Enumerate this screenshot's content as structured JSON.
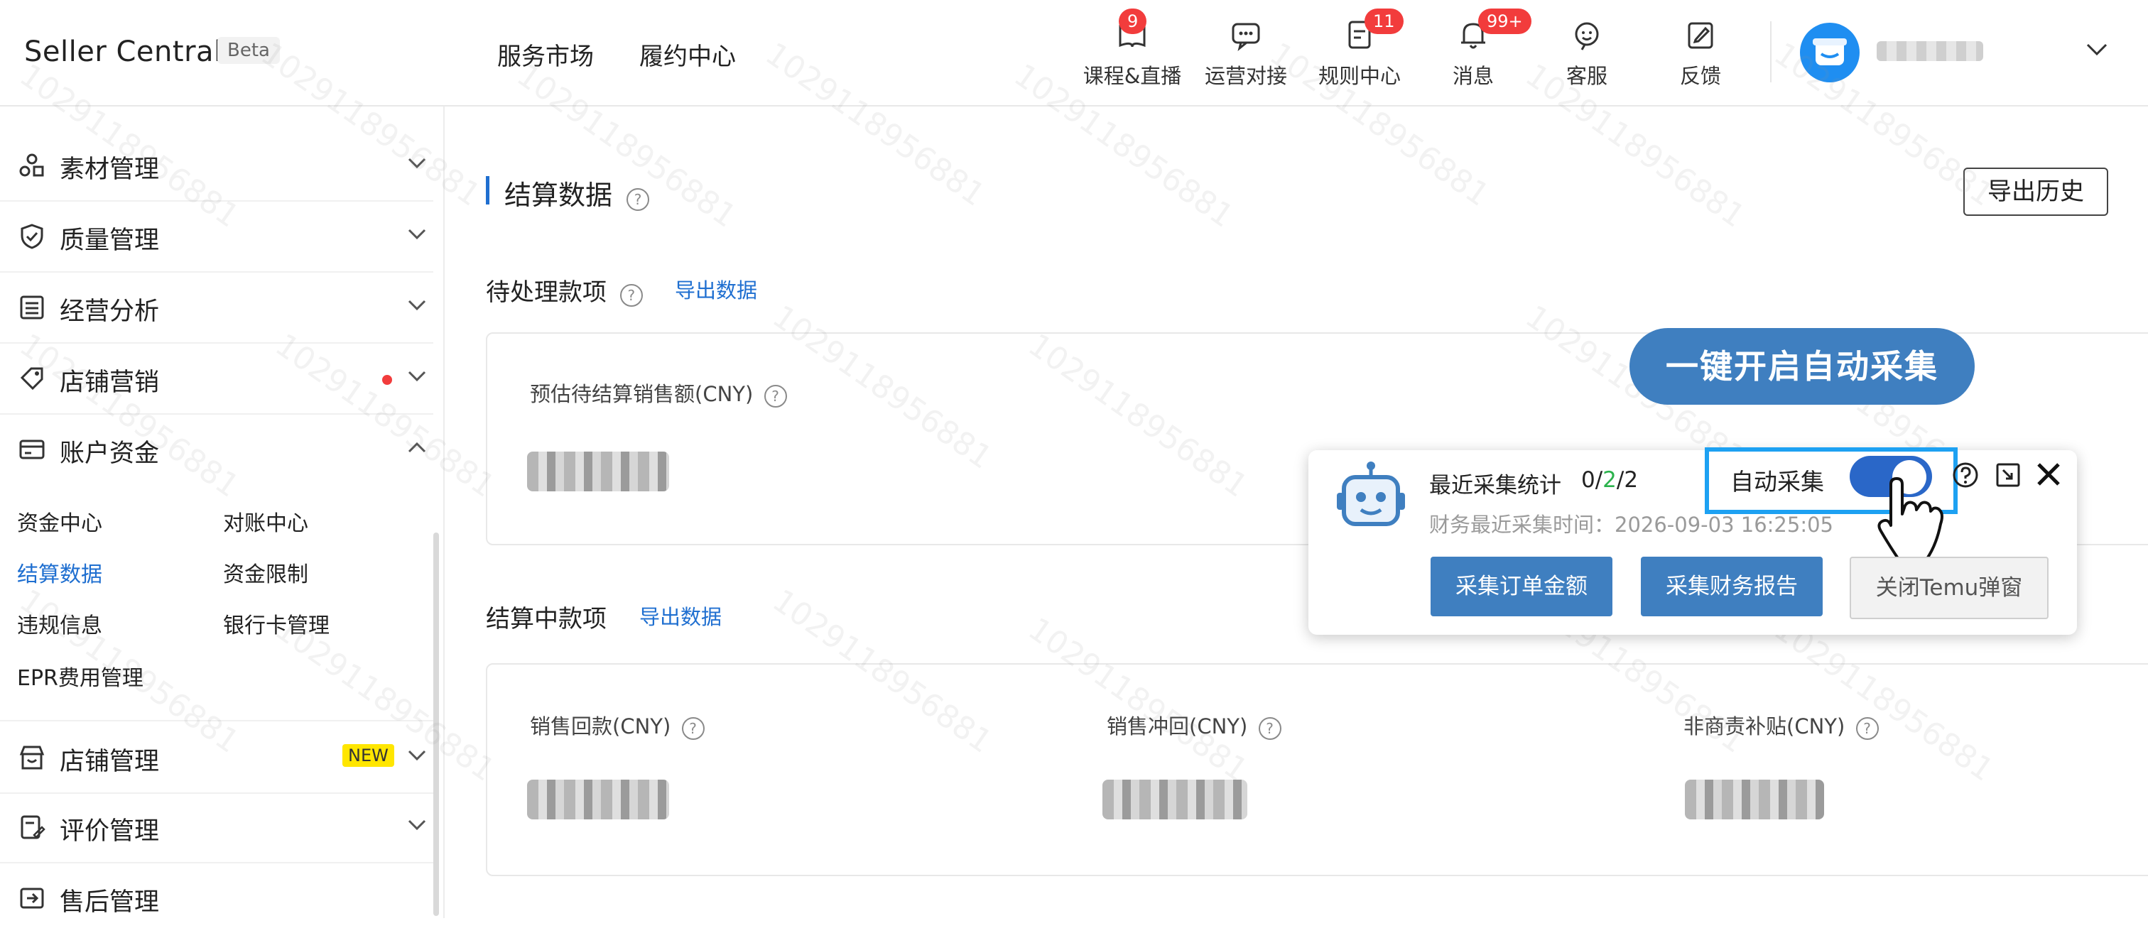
{
  "header": {
    "brand": "Seller Central",
    "beta": "Beta",
    "nav": [
      "服务市场",
      "履约中心"
    ],
    "icons": [
      {
        "name": "course-live",
        "icon": "book-icon",
        "label": "课程&直播",
        "badge": "9"
      },
      {
        "name": "ops-connect",
        "icon": "chat-icon",
        "label": "运营对接",
        "badge": ""
      },
      {
        "name": "rules-center",
        "icon": "document-icon",
        "label": "规则中心",
        "badge": "11"
      },
      {
        "name": "messages",
        "icon": "bell-icon",
        "label": "消息",
        "badge": "99+"
      },
      {
        "name": "customer-service",
        "icon": "support-icon",
        "label": "客服",
        "badge": ""
      },
      {
        "name": "feedback",
        "icon": "edit-icon",
        "label": "反馈",
        "badge": ""
      }
    ]
  },
  "sidebar": {
    "items": [
      {
        "label": "素材管理",
        "icon": "assets-icon",
        "state": "collapsed"
      },
      {
        "label": "质量管理",
        "icon": "shield-check-icon",
        "state": "collapsed"
      },
      {
        "label": "经营分析",
        "icon": "analytics-icon",
        "state": "collapsed"
      },
      {
        "label": "店铺营销",
        "icon": "tag-icon",
        "state": "collapsed",
        "red_dot": true
      },
      {
        "label": "账户资金",
        "icon": "wallet-icon",
        "state": "expanded"
      },
      {
        "label": "店铺管理",
        "icon": "store-icon",
        "state": "collapsed",
        "tag": "NEW"
      },
      {
        "label": "评价管理",
        "icon": "review-icon",
        "state": "collapsed"
      },
      {
        "label": "售后管理",
        "icon": "after-sale-icon",
        "state": "collapsed"
      }
    ],
    "subitems": [
      "资金中心",
      "对账中心",
      "结算数据",
      "资金限制",
      "违规信息",
      "银行卡管理",
      "EPR费用管理"
    ],
    "active_subitem": "结算数据"
  },
  "main": {
    "title": "结算数据",
    "export_history": "导出历史",
    "pending": {
      "title": "待处理款项",
      "export": "导出数据",
      "metric_label": "预估待结算销售额(CNY)"
    },
    "settling": {
      "title": "结算中款项",
      "export": "导出数据",
      "metrics": [
        "销售回款(CNY)",
        "销售冲回(CNY)",
        "非商责补贴(CNY)"
      ]
    }
  },
  "watermark": "1029118956881",
  "overlay": {
    "pill": "一键开启自动采集",
    "stat_label": "最近采集统计",
    "stat_value": {
      "a": "0/",
      "b": "2",
      "c": "/2"
    },
    "time_label": "财务最近采集时间：2026-09-03 16:25:05",
    "auto_label": "自动采集",
    "auto_enabled": true,
    "buttons": [
      "采集订单金额",
      "采集财务报告",
      "关闭Temu弹窗"
    ]
  },
  "colors": {
    "accent": "#1f6fd0",
    "button_blue": "#3f7fc0",
    "badge_red": "#f23c3c",
    "highlight_cyan": "#1da1f2",
    "new_tag": "#ffe600"
  }
}
